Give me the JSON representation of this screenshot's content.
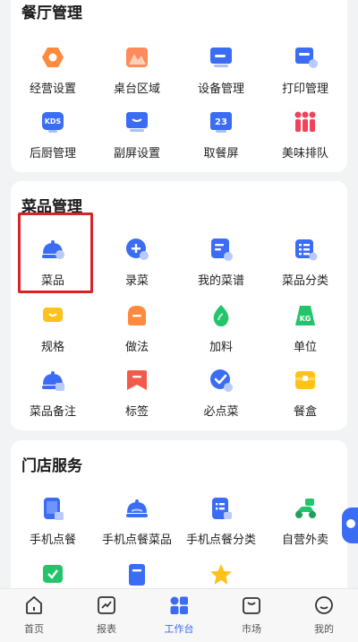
{
  "sections": {
    "restaurant": {
      "title": "餐厅管理",
      "items": [
        {
          "label": "经营设置",
          "icon": "business-settings-icon"
        },
        {
          "label": "桌台区域",
          "icon": "table-area-icon"
        },
        {
          "label": "设备管理",
          "icon": "device-icon"
        },
        {
          "label": "打印管理",
          "icon": "printer-icon"
        },
        {
          "label": "后厨管理",
          "icon": "kds-icon"
        },
        {
          "label": "副屏设置",
          "icon": "secondary-screen-icon"
        },
        {
          "label": "取餐屏",
          "icon": "pickup-screen-icon"
        },
        {
          "label": "美味排队",
          "icon": "queue-icon"
        }
      ]
    },
    "dish": {
      "title": "菜品管理",
      "items": [
        {
          "label": "菜品",
          "icon": "dish-cloche-icon"
        },
        {
          "label": "录菜",
          "icon": "add-dish-icon"
        },
        {
          "label": "我的菜谱",
          "icon": "my-menu-icon"
        },
        {
          "label": "菜品分类",
          "icon": "dish-category-icon"
        },
        {
          "label": "规格",
          "icon": "spec-icon"
        },
        {
          "label": "做法",
          "icon": "method-icon"
        },
        {
          "label": "加料",
          "icon": "topping-icon"
        },
        {
          "label": "单位",
          "icon": "unit-icon"
        },
        {
          "label": "菜品备注",
          "icon": "dish-note-icon"
        },
        {
          "label": "标签",
          "icon": "tag-icon"
        },
        {
          "label": "必点菜",
          "icon": "must-order-icon"
        },
        {
          "label": "餐盒",
          "icon": "meal-box-icon"
        }
      ]
    },
    "store": {
      "title": "门店服务",
      "items": [
        {
          "label": "手机点餐",
          "icon": "mobile-order-icon"
        },
        {
          "label": "手机点餐菜品",
          "icon": "mobile-dish-icon"
        },
        {
          "label": "手机点餐分类",
          "icon": "mobile-category-icon"
        },
        {
          "label": "自营外卖",
          "icon": "delivery-scooter-icon"
        },
        {
          "label": "",
          "icon": "check-board-icon"
        },
        {
          "label": "",
          "icon": "store-doc-icon"
        },
        {
          "label": "",
          "icon": "star-icon"
        }
      ]
    }
  },
  "unit_badge": "KG",
  "kds_badge": "KDS",
  "pickup_badge": "23",
  "tabbar": [
    {
      "label": "首页",
      "icon": "home-icon"
    },
    {
      "label": "报表",
      "icon": "report-icon"
    },
    {
      "label": "工作台",
      "icon": "workbench-icon"
    },
    {
      "label": "市场",
      "icon": "market-icon"
    },
    {
      "label": "我的",
      "icon": "profile-icon"
    }
  ],
  "colors": {
    "accent": "#3a6cf4",
    "highlight": "#d8232a",
    "orange": "#ff8a3d",
    "yellow": "#ffc21a",
    "green": "#23c46b",
    "red": "#f0435a"
  }
}
